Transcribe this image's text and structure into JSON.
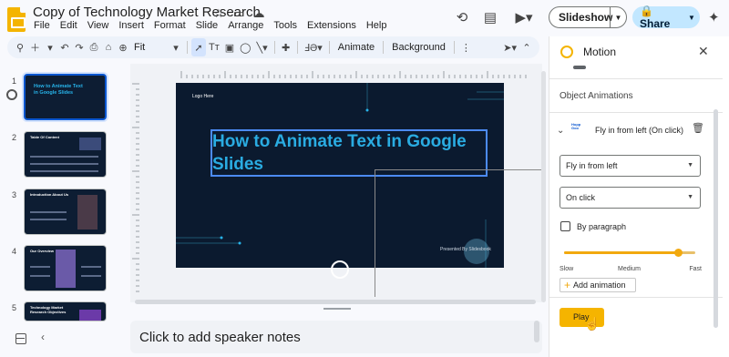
{
  "header": {
    "title": "Copy of Technology Market Research",
    "menu": [
      "File",
      "Edit",
      "View",
      "Insert",
      "Format",
      "Slide",
      "Arrange",
      "Tools",
      "Extensions",
      "Help"
    ],
    "slideshow_label": "Slideshow",
    "share_label": "Share"
  },
  "toolbar": {
    "zoom": "Fit",
    "animate_label": "Animate",
    "background_label": "Background"
  },
  "filmstrip": {
    "slides": [
      {
        "num": "1",
        "title": "How to Animate Text in Google Slides"
      },
      {
        "num": "2",
        "title": "Table Of Content"
      },
      {
        "num": "3",
        "title": "Introduction About Us"
      },
      {
        "num": "4",
        "title": "Our Overview"
      },
      {
        "num": "5",
        "title": "Technology Market Research Objectives"
      }
    ]
  },
  "slide": {
    "logo_text": "Logo Here",
    "title": "How to Animate Text in Google Slides",
    "presented_by": "Presented By Slidesbook"
  },
  "notes": {
    "placeholder": "Click to add speaker notes"
  },
  "motion_panel": {
    "title": "Motion",
    "section_label": "Object Animations",
    "item_thumb_text": "Hopp Goo",
    "item_label": "Fly in from left  (On click)",
    "effect_value": "Fly in from left",
    "trigger_value": "On click",
    "by_paragraph_label": "By paragraph",
    "speed_value": 0.87,
    "speed_labels": {
      "slow": "Slow",
      "medium": "Medium",
      "fast": "Fast"
    },
    "add_animation_label": "Add animation",
    "play_label": "Play"
  },
  "colors": {
    "accent": "#0b57d0",
    "slide_bg": "#0b1a2f",
    "slide_title": "#2aace2",
    "play_button": "#f5b400"
  }
}
